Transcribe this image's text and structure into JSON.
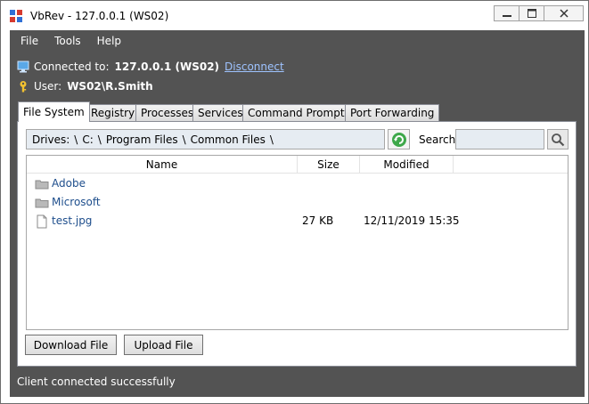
{
  "window": {
    "title": "VbRev - 127.0.0.1 (WS02)"
  },
  "menu": [
    "File",
    "Tools",
    "Help"
  ],
  "connection": {
    "connected_label": "Connected to:",
    "host": "127.0.0.1 (WS02)",
    "disconnect": "Disconnect",
    "user_label": "User:",
    "user": "WS02\\R.Smith"
  },
  "tabs": [
    "File System",
    "Registry",
    "Processes",
    "Services",
    "Command Prompt",
    "Port Forwarding"
  ],
  "path": {
    "segments": [
      "Drives:",
      "\\",
      "C:",
      "\\",
      "Program Files",
      "\\",
      "Common Files",
      "\\"
    ]
  },
  "search": {
    "label": "Search:",
    "value": ""
  },
  "columns": {
    "name": "Name",
    "size": "Size",
    "modified": "Modified"
  },
  "files": [
    {
      "name": "Adobe",
      "size": "",
      "modified": "",
      "type": "folder"
    },
    {
      "name": "Microsoft",
      "size": "",
      "modified": "",
      "type": "folder"
    },
    {
      "name": "test.jpg",
      "size": "27 KB",
      "modified": "12/11/2019 15:35",
      "type": "file"
    }
  ],
  "buttons": {
    "download": "Download File",
    "upload": "Upload File"
  },
  "status": "Client connected successfully",
  "colors": {
    "panel_dark": "#535353",
    "link": "#9ec3ff",
    "path_bg": "#e6ecf2"
  }
}
